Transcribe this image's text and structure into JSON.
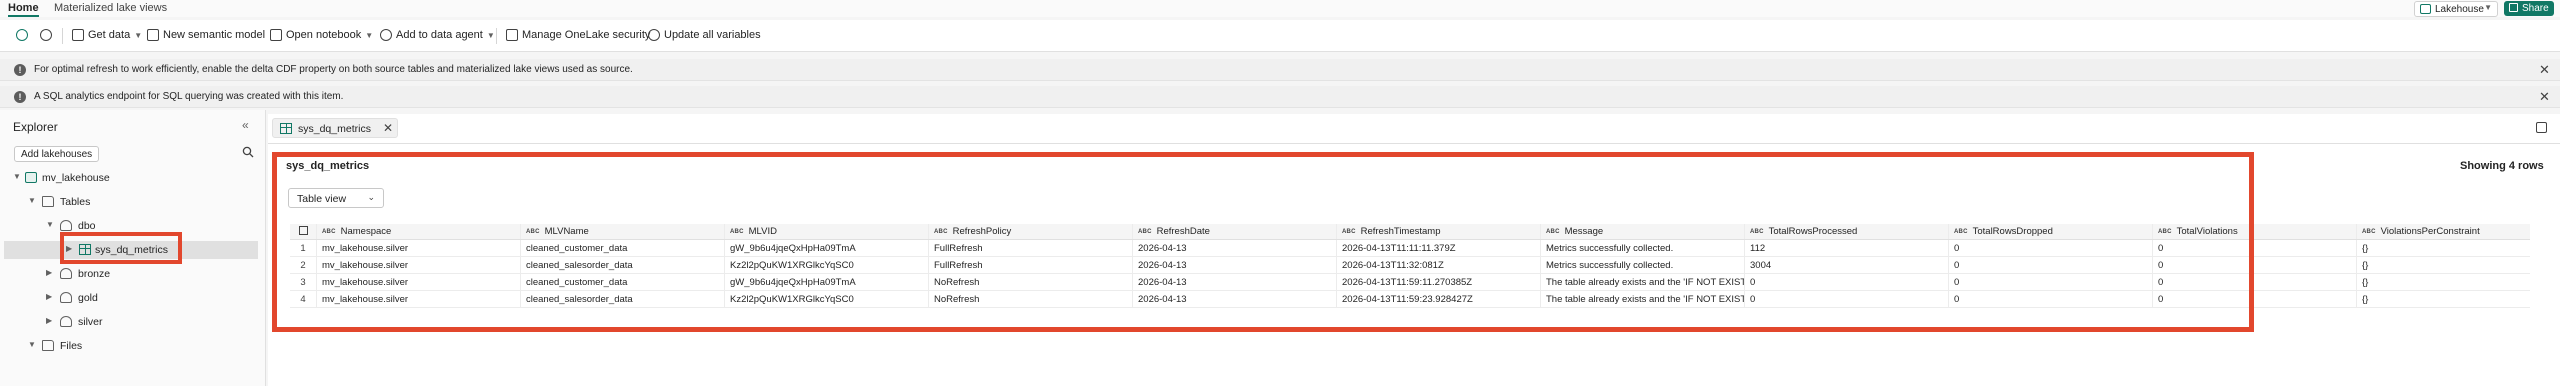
{
  "top_tabs": [
    "Home",
    "Materialized lake views"
  ],
  "lakehouse_selector": "Lakehouse",
  "share_label": "Share",
  "ribbon": {
    "get_data": "Get data",
    "new_semantic_model": "New semantic model",
    "open_notebook": "Open notebook",
    "add_to_data_agent": "Add to data agent",
    "manage_onelake_security": "Manage OneLake security",
    "update_all_variables": "Update all variables"
  },
  "banners": [
    "For optimal refresh to work efficiently, enable the delta CDF property on both source tables and materialized lake views used as source.",
    "A SQL analytics endpoint for SQL querying was created with this item."
  ],
  "explorer": {
    "title": "Explorer",
    "add_lakehouses": "Add lakehouses",
    "tree": {
      "lakehouse": "mv_lakehouse",
      "tables": "Tables",
      "dbo": "dbo",
      "sys_dq_metrics": "sys_dq_metrics",
      "bronze": "bronze",
      "gold": "gold",
      "silver": "silver",
      "files": "Files"
    }
  },
  "main": {
    "tab_label": "sys_dq_metrics",
    "table_title": "sys_dq_metrics",
    "row_count": "Showing 4 rows",
    "view_select": "Table view",
    "type_tag": "ABC",
    "columns": [
      "Namespace",
      "MLVName",
      "MLVID",
      "RefreshPolicy",
      "RefreshDate",
      "RefreshTimestamp",
      "Message",
      "TotalRowsProcessed",
      "TotalRowsDropped",
      "TotalViolations",
      "ViolationsPerConstraint"
    ],
    "rows": [
      {
        "n": "1",
        "cells": [
          "mv_lakehouse.silver",
          "cleaned_customer_data",
          "gW_9b6u4jqeQxHpHa09TmA",
          "FullRefresh",
          "2026-04-13",
          "2026-04-13T11:11:11.379Z",
          "Metrics successfully collected.",
          "112",
          "0",
          "0",
          "{}"
        ]
      },
      {
        "n": "2",
        "cells": [
          "mv_lakehouse.silver",
          "cleaned_salesorder_data",
          "Kz2l2pQuKW1XRGlkcYqSC0",
          "FullRefresh",
          "2026-04-13",
          "2026-04-13T11:32:081Z",
          "Metrics successfully collected.",
          "3004",
          "0",
          "0",
          "{}"
        ]
      },
      {
        "n": "3",
        "cells": [
          "mv_lakehouse.silver",
          "cleaned_customer_data",
          "gW_9b6u4jqeQxHpHa09TmA",
          "NoRefresh",
          "2026-04-13",
          "2026-04-13T11:59:11.270385Z",
          "The table already exists and the 'IF NOT EXISTS...",
          "0",
          "0",
          "0",
          "{}"
        ]
      },
      {
        "n": "4",
        "cells": [
          "mv_lakehouse.silver",
          "cleaned_salesorder_data",
          "Kz2l2pQuKW1XRGlkcYqSC0",
          "NoRefresh",
          "2026-04-13",
          "2026-04-13T11:59:23.928427Z",
          "The table already exists and the 'IF NOT EXISTS...",
          "0",
          "0",
          "0",
          "{}"
        ]
      }
    ]
  }
}
